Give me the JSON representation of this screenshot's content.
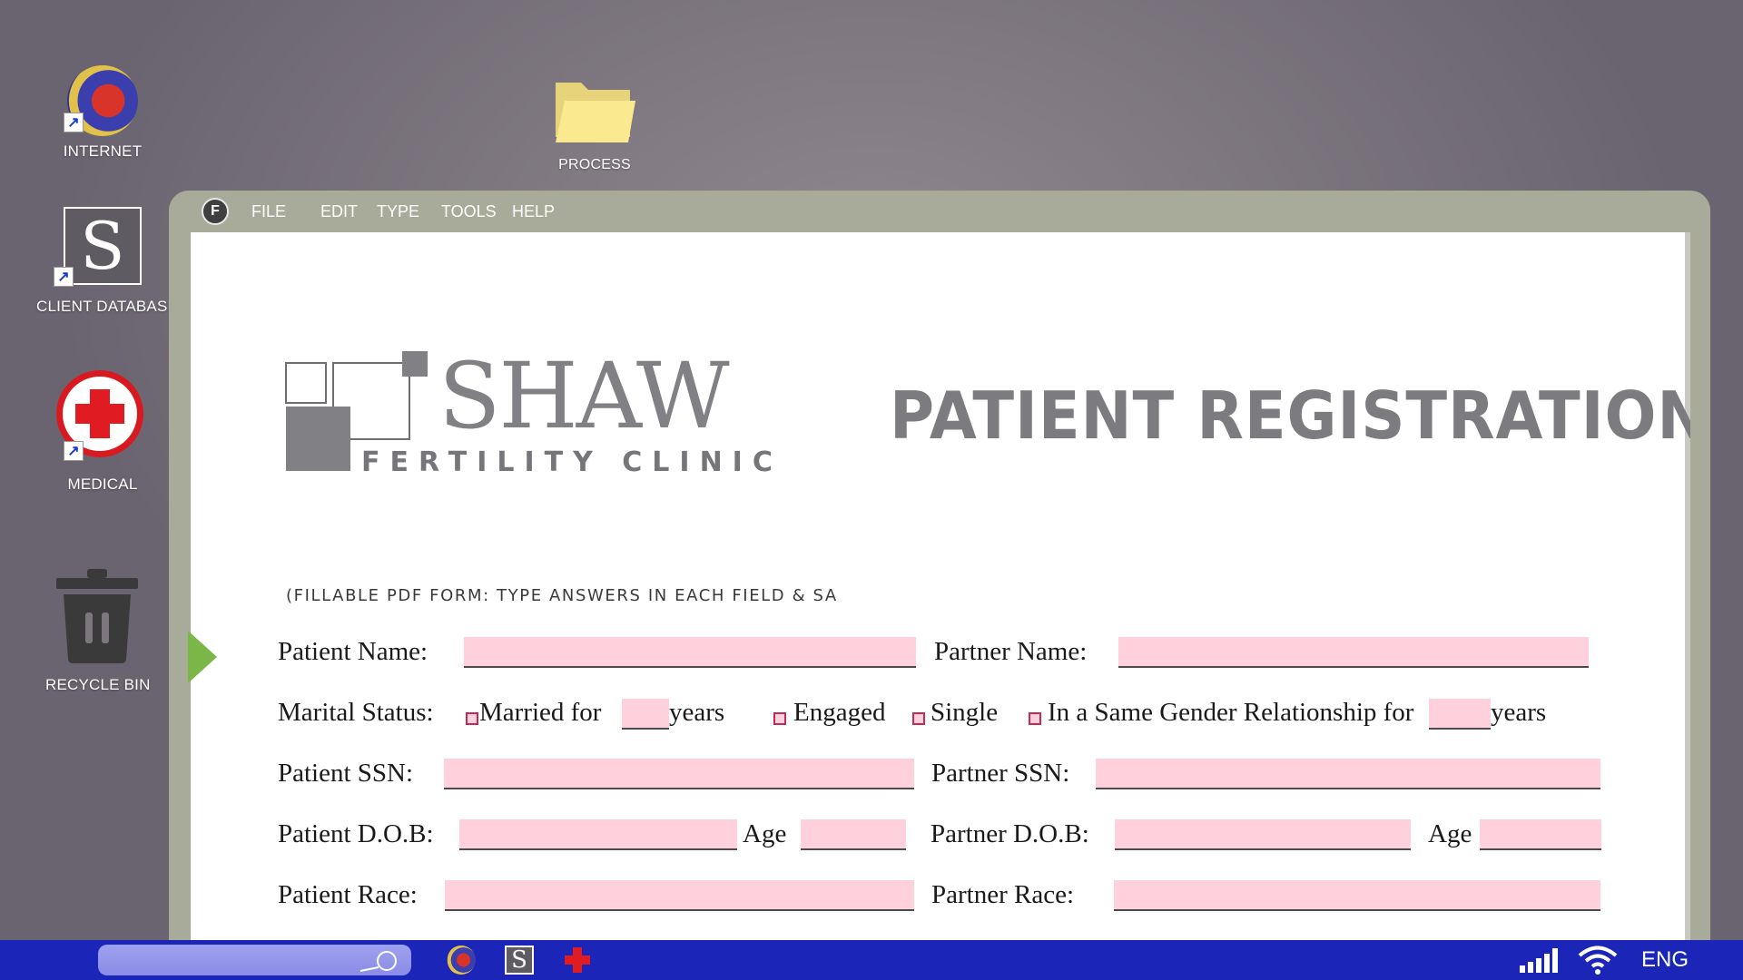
{
  "desktop": {
    "icons": [
      {
        "label": "INTERNET"
      },
      {
        "label": "PROCESS"
      },
      {
        "label": "CLIENT DATABASE"
      },
      {
        "label": "MEDICAL"
      },
      {
        "label": "RECYCLE BIN"
      }
    ]
  },
  "app": {
    "logo_letter": "F",
    "menu": [
      "FILE",
      "EDIT",
      "TYPE",
      "TOOLS",
      "HELP"
    ]
  },
  "document": {
    "clinic_name": "SHAW",
    "clinic_subname": "FERTILITY CLINIC",
    "title": "PATIENT REGISTRATION",
    "instructions": "(FILLABLE PDF FORM: TYPE ANSWERS IN EACH FIELD & SA",
    "fields": {
      "patient_name_label": "Patient Name:",
      "partner_name_label": "Partner Name:",
      "marital_status_label": "Marital Status:",
      "married_for": "Married for",
      "years": "years",
      "engaged": "Engaged",
      "single": "Single",
      "same_gender": "In a Same Gender Relationship for",
      "patient_ssn_label": "Patient SSN:",
      "partner_ssn_label": "Partner SSN:",
      "patient_dob_label": "Patient D.O.B:",
      "age_label": "Age",
      "partner_dob_label": "Partner D.O.B:",
      "patient_race_label": "Patient Race:",
      "partner_race_label": "Partner Race:"
    }
  },
  "taskbar": {
    "language": "ENG"
  },
  "colors": {
    "taskbar": "#1b25b8",
    "field_fill": "#ffd1dd",
    "window_frame": "#a8aa9a",
    "page_marker": "#7ab648"
  }
}
